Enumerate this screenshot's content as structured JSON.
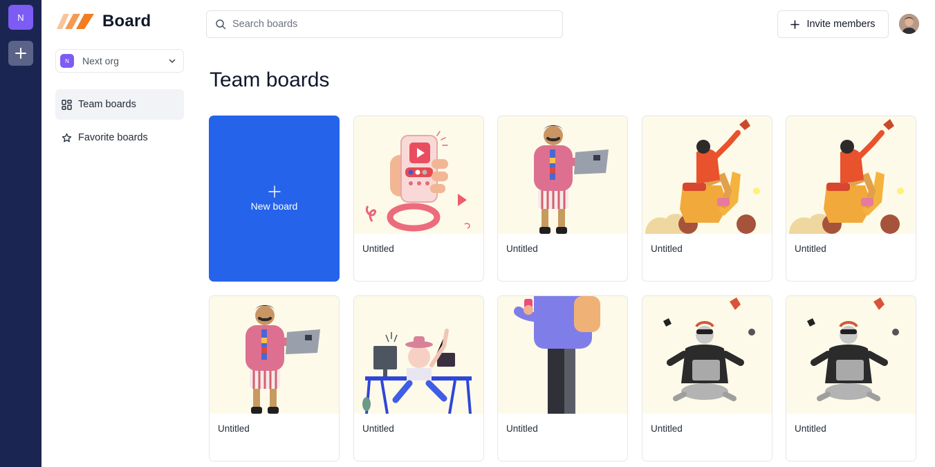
{
  "rail": {
    "org_initial": "N",
    "add_icon": "plus-icon"
  },
  "sidebar": {
    "logo_text": "Board",
    "org_switcher": {
      "avatar_initial": "N",
      "name": "Next org",
      "icon": "chevron-down-icon"
    },
    "nav": [
      {
        "label": "Team boards",
        "icon": "layout-grid-icon",
        "active": true
      },
      {
        "label": "Favorite boards",
        "icon": "star-icon",
        "active": false
      }
    ]
  },
  "header": {
    "search_placeholder": "Search boards",
    "invite_label": "Invite members"
  },
  "main": {
    "title": "Team boards",
    "new_board_label": "New board",
    "boards": [
      {
        "title": "Untitled",
        "illustration": "hand-holding-phone"
      },
      {
        "title": "Untitled",
        "illustration": "man-with-laptop"
      },
      {
        "title": "Untitled",
        "illustration": "woman-on-scooter"
      },
      {
        "title": "Untitled",
        "illustration": "woman-on-scooter"
      },
      {
        "title": "Untitled",
        "illustration": "man-with-laptop"
      },
      {
        "title": "Untitled",
        "illustration": "person-at-desk"
      },
      {
        "title": "Untitled",
        "illustration": "person-with-phone"
      },
      {
        "title": "Untitled",
        "illustration": "robot-with-laptop"
      },
      {
        "title": "Untitled",
        "illustration": "robot-with-laptop"
      }
    ]
  },
  "colors": {
    "rail": "#1b2552",
    "accent": "#7c5cf4",
    "new_board": "#2563eb",
    "thumb_bg": "#fdfae9"
  }
}
